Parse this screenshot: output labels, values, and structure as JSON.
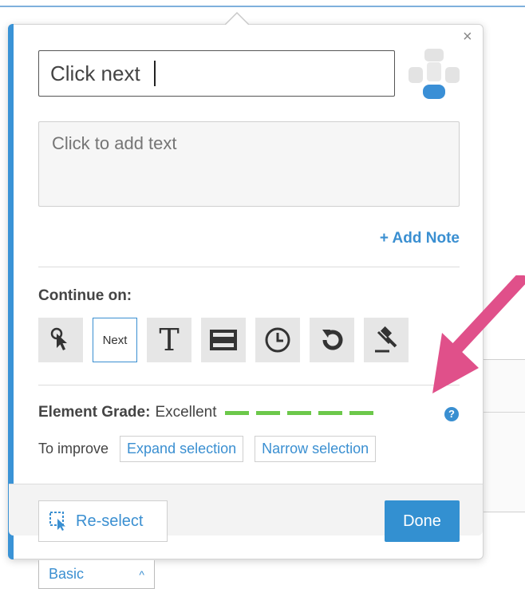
{
  "popover": {
    "close_symbol": "×",
    "title_value": "Click next",
    "text_placeholder": "Click to add text",
    "add_note_label": "+ Add Note",
    "continue_label": "Continue on:",
    "triggers": [
      {
        "icon": "pointer-click-icon"
      },
      {
        "label": "Next",
        "active": true
      },
      {
        "label": "T",
        "icon": "text-icon"
      },
      {
        "icon": "input-field-icon"
      },
      {
        "icon": "clock-icon"
      },
      {
        "icon": "redo-icon"
      },
      {
        "icon": "gavel-icon"
      }
    ],
    "grade": {
      "label": "Element Grade:",
      "value": "Excellent",
      "level": 5,
      "color": "#6cc84a",
      "help": "?"
    },
    "improve": {
      "label": "To improve",
      "expand": "Expand selection",
      "narrow": "Narrow selection"
    },
    "reselect_label": "Re-select",
    "done_label": "Done",
    "accent_color": "#3a93d6"
  },
  "basic_tab": {
    "label": "Basic",
    "chevron": "^"
  },
  "annotation": {
    "arrow_color": "#e0508a"
  }
}
